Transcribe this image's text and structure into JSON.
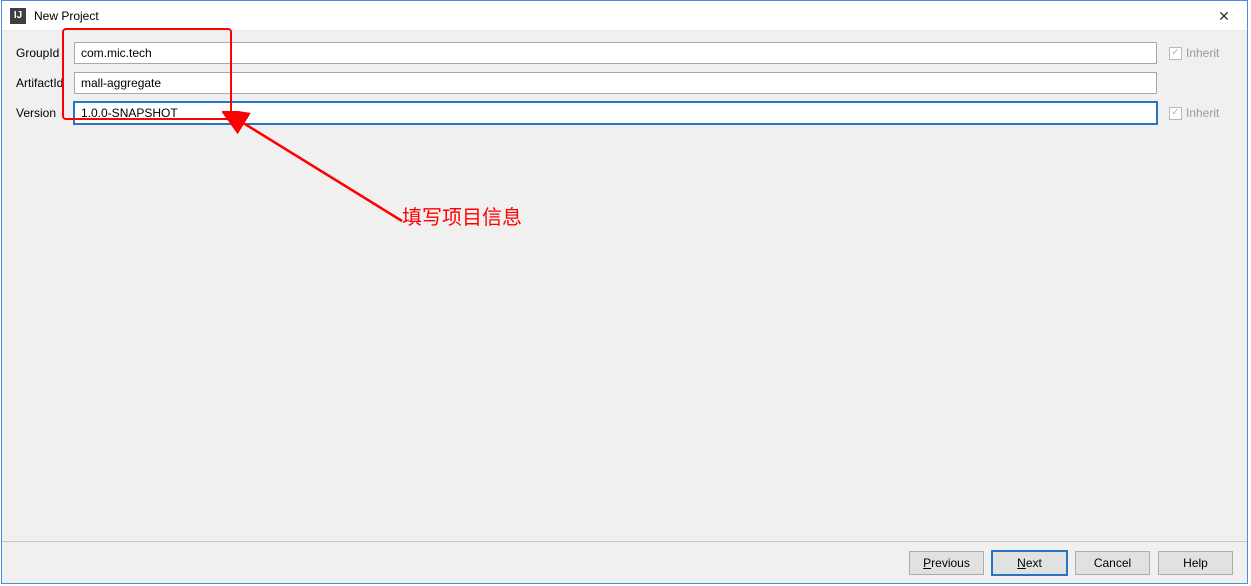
{
  "window": {
    "title": "New Project",
    "close_label": "✕"
  },
  "form": {
    "groupId": {
      "label": "GroupId",
      "value": "com.mic.tech",
      "inherit_label": "Inherit",
      "inherit_visible": true
    },
    "artifactId": {
      "label": "ArtifactId",
      "value": "mall-aggregate"
    },
    "version": {
      "label": "Version",
      "value": "1.0.0-SNAPSHOT",
      "inherit_label": "Inherit",
      "inherit_visible": true
    }
  },
  "buttons": {
    "previous": "Previous",
    "next": "Next",
    "cancel": "Cancel",
    "help": "Help"
  },
  "annotation": {
    "text": "填写项目信息"
  }
}
